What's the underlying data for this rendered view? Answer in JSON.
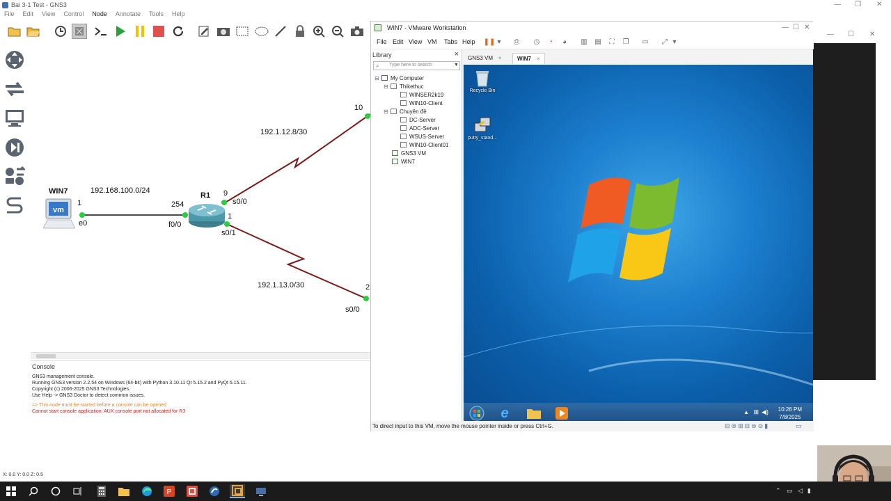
{
  "gns3": {
    "title": "Bai 3-1 Test - GNS3",
    "menu": [
      "File",
      "Edit",
      "View",
      "Control",
      "Node",
      "Annotate",
      "Tools",
      "Help"
    ],
    "toolbar_icons": [
      "open-folder-icon",
      "open-project-icon",
      "snapshot-icon",
      "show-interface-labels-icon",
      "console-all-icon",
      "start-all-icon",
      "suspend-all-icon",
      "stop-all-icon",
      "reload-all-icon",
      "add-note-icon",
      "insert-picture-icon",
      "draw-rectangle-icon",
      "draw-ellipse-icon",
      "draw-line-icon",
      "lock-icon",
      "zoom-in-icon",
      "zoom-out-icon",
      "screenshot-icon"
    ],
    "side_icons": [
      "routers-icon",
      "switches-icon",
      "end-devices-icon",
      "security-devices-icon",
      "all-devices-icon",
      "add-link-icon"
    ],
    "topology": {
      "nodes": {
        "win7": {
          "label": "WIN7",
          "port": "1",
          "iface": "e0"
        },
        "r1": {
          "label": "R1"
        }
      },
      "links": {
        "lan": "192.168.100.0/24",
        "r1_f0": "254",
        "r1_f0_iface": "f0/0",
        "r1_s00_num": "9",
        "r1_s00": "s0/0",
        "r1_s01_num": "1",
        "r1_s01": "s0/1",
        "net12": "192.1.12.8/30",
        "net13": "192.1.13.0/30",
        "r2_num": "10",
        "r3_num": "2",
        "r3_iface": "s0/0"
      }
    },
    "console": {
      "title": "Console",
      "lines": [
        "GNS3 management console.",
        "Running GNS3 version 2.2.54 on Windows (64-bit) with Python 3.10.11 Qt 5.15.2 and PyQt 5.15.11.",
        "Copyright (c) 2006-2025 GNS3 Technologies.",
        "Use Help -> GNS3 Doctor to detect common issues."
      ],
      "warning": "=> This node must be started before a console can be opened",
      "error": "Cannot start console application: AUX console port not allocated for R3"
    },
    "status": "X: 0.0 Y: 0.0 Z: 0.5"
  },
  "vmware": {
    "title": "WIN7 - VMware Workstation",
    "menu": [
      "File",
      "Edit",
      "View",
      "VM",
      "Tabs",
      "Help"
    ],
    "library": {
      "title": "Library",
      "search_placeholder": "Type here to search",
      "tree": [
        {
          "label": "My Computer",
          "level": 0,
          "kind": "computer"
        },
        {
          "label": "Thikethuc",
          "level": 1,
          "kind": "folder"
        },
        {
          "label": "WINSER2k19",
          "level": 2,
          "kind": "vm"
        },
        {
          "label": "WIN10-Client",
          "level": 2,
          "kind": "vm"
        },
        {
          "label": "Chuyên đề",
          "level": 1,
          "kind": "folder"
        },
        {
          "label": "DC-Server",
          "level": 2,
          "kind": "vm"
        },
        {
          "label": "ADC-Server",
          "level": 2,
          "kind": "vm"
        },
        {
          "label": "WSUS-Server",
          "level": 2,
          "kind": "vm"
        },
        {
          "label": "WIN10-Client01",
          "level": 2,
          "kind": "vm"
        },
        {
          "label": "GNS3 VM",
          "level": 1,
          "kind": "vm-running"
        },
        {
          "label": "WIN7",
          "level": 1,
          "kind": "vm-running"
        }
      ]
    },
    "tabs": [
      {
        "label": "GNS3 VM",
        "active": false
      },
      {
        "label": "WIN7",
        "active": true
      }
    ],
    "guest": {
      "icons": [
        "Recycle Bin",
        "putty_stand..."
      ],
      "time": "10:26 PM",
      "date": "7/8/2025"
    },
    "status": "To direct input to this VM, move the mouse pointer inside or press Ctrl+G."
  },
  "colors": {
    "link_serial": "#7a1a1a",
    "link_port_up": "#2ecc40",
    "guest_desktop": "#1c7fcf",
    "taskbar": "#1b1b1b"
  }
}
